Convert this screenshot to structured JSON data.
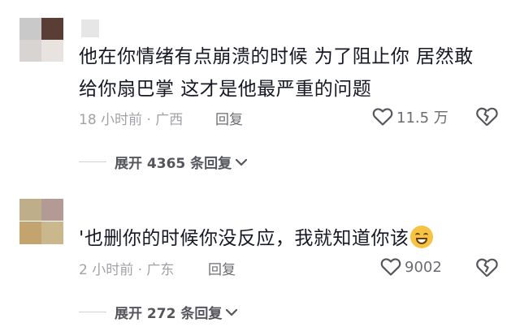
{
  "comments": [
    {
      "text_line1": "他在你情绪有点崩溃的时候   为了阻止你   居然敢",
      "text_line2": "给你扇巴掌    这才是他最严重的问题",
      "meta": "18 小时前 · 广西",
      "reply_label": "回复",
      "likes": "11.5 万",
      "expand_label": "展开 4365 条回复",
      "avatar_colors": [
        "#c9c9c9",
        "#5a3e36",
        "#d8d4d1",
        "#e8e3df"
      ]
    },
    {
      "text": "'也删你的时候你没反应，我就知道你该",
      "meta": "2 小时前 · 广东",
      "reply_label": "回复",
      "likes": "9002",
      "expand_label": "展开 272 条回复",
      "emoji": "grinning-sweat-emoji",
      "avatar_colors": [
        "#bfae8a",
        "#b39a94",
        "#c4a46e",
        "#cbb78c"
      ]
    }
  ],
  "colors": {
    "text": "#161823",
    "meta": "#a1a2a7",
    "action": "#6b6c72"
  }
}
